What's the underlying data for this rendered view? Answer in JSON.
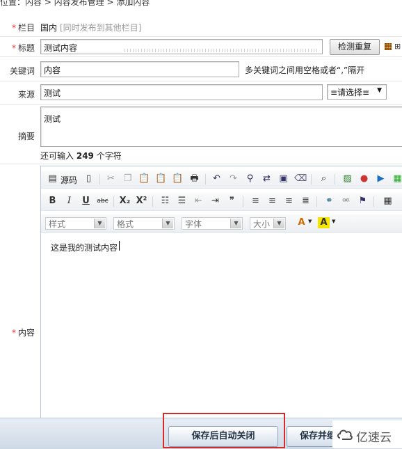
{
  "breadcrumb": "位置：内容 > 内容发布管理 > 添加内容",
  "form": {
    "column_label": "栏目",
    "column_value": "国内",
    "column_hint": "[同时发布到其他栏目]",
    "title_label": "标题",
    "title_value": "测试内容",
    "check_duplicate_label": "检测重复",
    "keywords_label": "关键词",
    "keywords_value": "内容",
    "keywords_hint": "多关键词之间用空格或者“,”隔开",
    "source_label": "来源",
    "source_value": "测试",
    "source_select": "≡请选择≡",
    "summary_label": "摘要",
    "summary_value": "测试",
    "summary_count_prefix": "还可输入",
    "summary_count": "249",
    "summary_count_suffix": "个字符",
    "content_label": "内容"
  },
  "editor": {
    "source_label": "源码",
    "style_combo": "样式",
    "format_combo": "格式",
    "font_combo": "字体",
    "size_combo": "大小",
    "content_text": "这是我的测试内容",
    "toolbar_row1_icons": [
      "page-icon",
      "cut-icon",
      "copy-icon",
      "paste-icon",
      "paste-text-icon",
      "paste-word-icon",
      "print-icon",
      "undo-icon",
      "redo-icon",
      "find-icon",
      "replace-icon",
      "select-all-icon",
      "remove-format-icon",
      "preview-icon",
      "image-icon",
      "flash-icon",
      "media-icon"
    ],
    "toolbar_row2_icons": [
      "bold-icon",
      "italic-icon",
      "underline-icon",
      "strike-icon",
      "subscript-icon",
      "superscript-icon",
      "ordered-list-icon",
      "bullet-list-icon",
      "outdent-icon",
      "indent-icon",
      "blockquote-icon",
      "align-left-icon",
      "align-center-icon",
      "align-right-icon",
      "justify-icon",
      "link-icon",
      "unlink-icon",
      "anchor-icon",
      "table-icon"
    ],
    "glyphs": {
      "bold": "B",
      "italic": "I",
      "underline": "U",
      "strike": "abc",
      "sub": "X₂",
      "sup": "X²",
      "quote": "❞",
      "font_color": "A",
      "bg_color": "A"
    }
  },
  "actions": {
    "save_close_label": "保存后自动关闭",
    "save_continue_label": "保存并继"
  },
  "watermark": "亿速云",
  "colors": {
    "required": "#ee3333",
    "highlight": "#d12b2b",
    "bg_color_button": "#f5e400"
  }
}
